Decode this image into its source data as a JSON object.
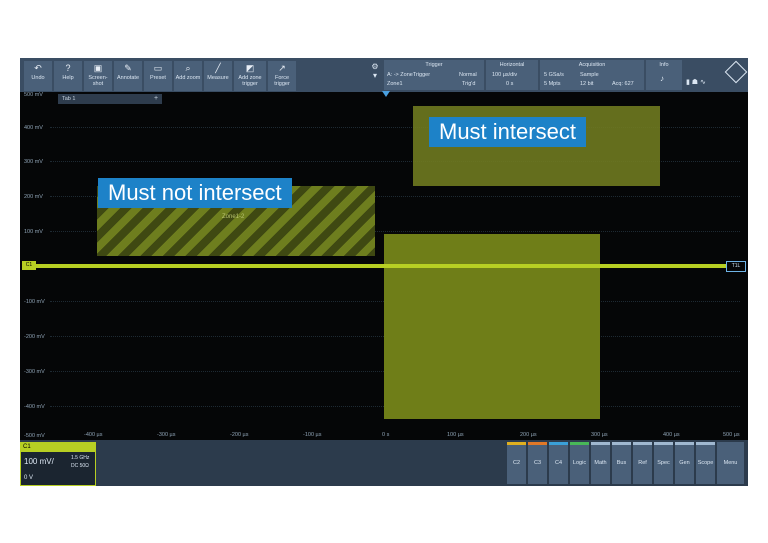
{
  "toolbar": {
    "undo": "Undo",
    "help": "Help",
    "screenshot": "Screen-shot",
    "annotate": "Annotate",
    "preset": "Preset",
    "add_zoom": "Add zoom",
    "measure": "Measure",
    "add_zone_trigger": "Add zone trigger",
    "force_trigger": "Force trigger"
  },
  "info": {
    "trigger_header": "Trigger",
    "trigger_source": "A: -> ZoneTrigger",
    "trigger_sub": "Zone1",
    "trigger_mode": "Normal",
    "trigger_state": "Trig'd",
    "horizontal_header": "Horizontal",
    "horizontal_scale": "100 µs/div",
    "horizontal_pos": "0 s",
    "acquisition_header": "Acquisition",
    "acq_rate": "5 GSa/s",
    "acq_mem": "5 Mpts",
    "acq_mode": "Sample",
    "acq_bits": "12 bit",
    "acq_count": "Acq: 627",
    "info_header": "Info"
  },
  "graph": {
    "tab_label": "Tab 1",
    "y_labels": [
      "500 mV",
      "400 mV",
      "300 mV",
      "200 mV",
      "100 mV",
      "-100 mV",
      "-200 mV",
      "-300 mV",
      "-400 mV",
      "-500 mV"
    ],
    "x_labels": [
      "-400 µs",
      "-300 µs",
      "-200 µs",
      "-100 µs",
      "0 s",
      "100 µs",
      "200 µs",
      "300 µs",
      "400 µs",
      "500 µs"
    ],
    "zone_label": "Zone1-2",
    "channel_marker_left": "C1",
    "channel_marker_right": "T1L"
  },
  "callouts": {
    "must_not": "Must not intersect",
    "must": "Must intersect"
  },
  "bottom": {
    "c1_label": "C1",
    "c1_scale": "100 mV/",
    "c1_bw": "1.5 GHz",
    "c1_coupling": "DC 50Ω",
    "c1_offset": "0 V",
    "buttons": [
      "C2",
      "C3",
      "C4",
      "Logic",
      "Math",
      "Bus",
      "Ref",
      "Spec",
      "Gen",
      "Scope",
      "Menu"
    ]
  },
  "colors": {
    "trace": "#b7cf23",
    "callout": "#1d82c8",
    "zone_fill": "#6f7e18"
  }
}
